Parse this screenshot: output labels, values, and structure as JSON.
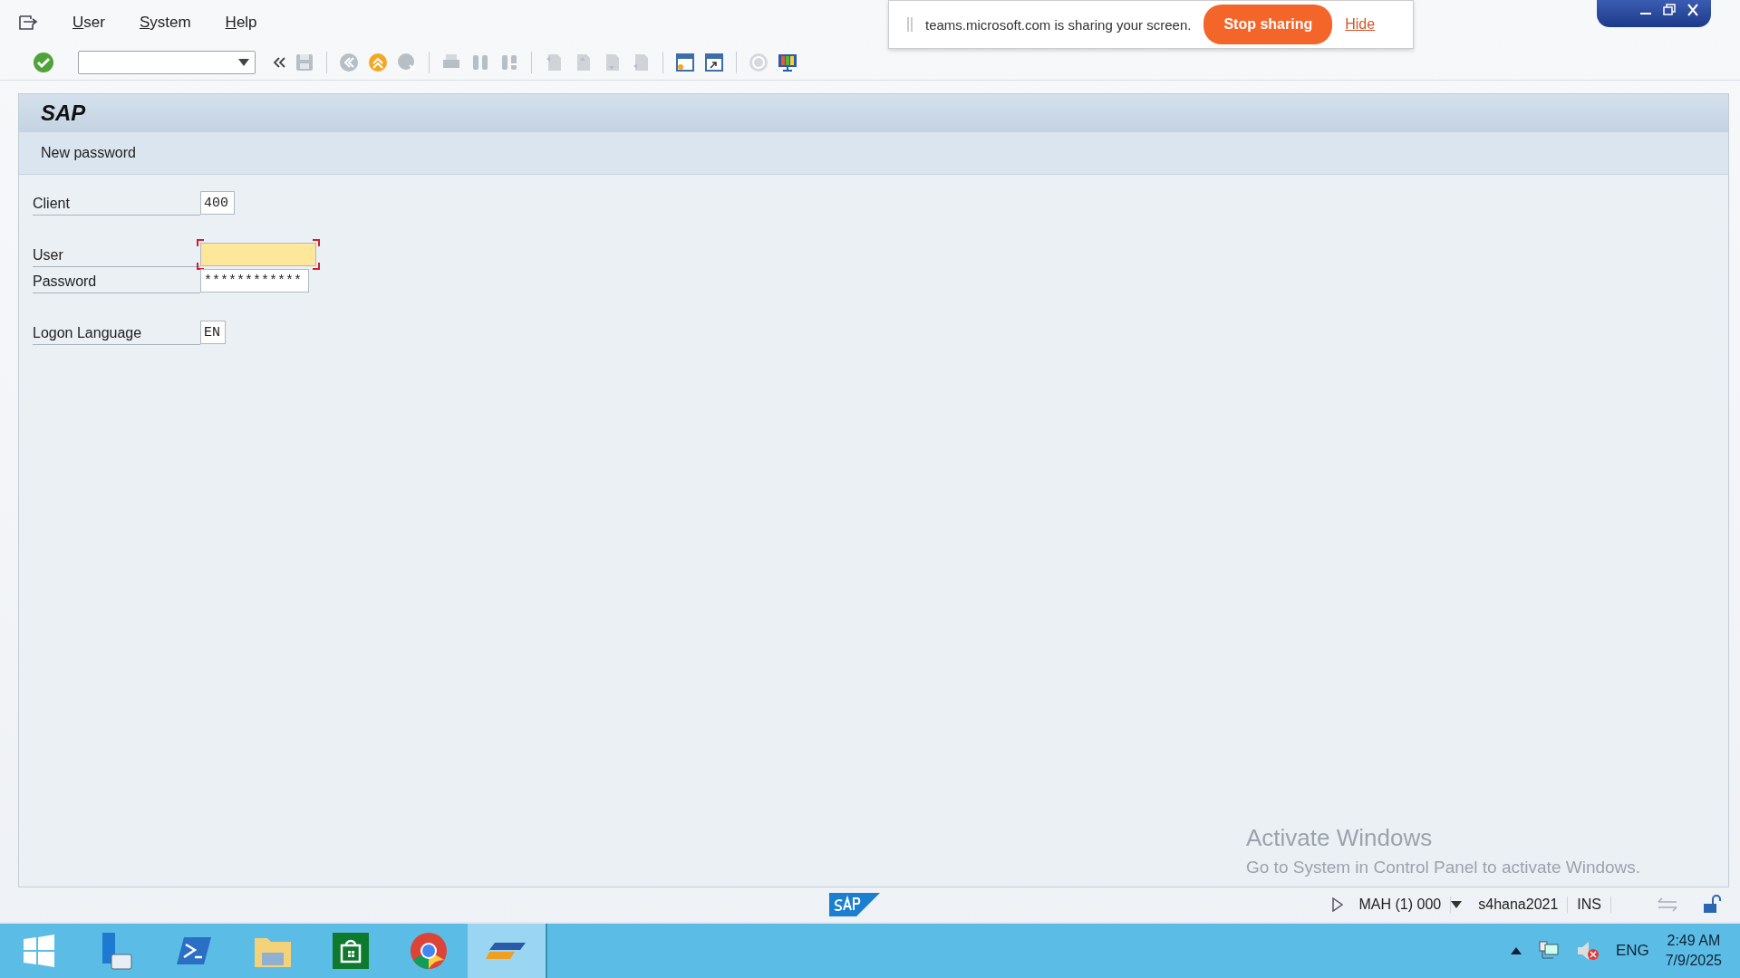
{
  "menu": [
    {
      "label": "User"
    },
    {
      "label": "System"
    },
    {
      "label": "Help"
    }
  ],
  "screen_sharing_banner": {
    "message": "teams.microsoft.com is sharing your screen.",
    "stop_button": "Stop sharing",
    "hide_link": "Hide"
  },
  "header": {
    "title": "SAP",
    "subtitle": "New password"
  },
  "fields": [
    {
      "label": "Client",
      "value": "400",
      "focused": false
    },
    {
      "label": "User",
      "focused": true
    },
    {
      "label": "Password",
      "value": "************",
      "focused": false
    },
    {
      "label": "Logon Language",
      "value": "EN",
      "focused": false
    }
  ],
  "activation_notice": {
    "title": "Activate Windows",
    "text": "Go to System in Control Panel to activate Windows."
  },
  "status_bar": {
    "session": "MAH (1) 000",
    "server": "s4hana2021",
    "mode": "INS"
  },
  "taskbar": {
    "apps": [
      {
        "selected": false
      },
      {
        "selected": false
      },
      {
        "selected": false
      },
      {
        "selected": false
      },
      {
        "selected": false
      },
      {
        "selected": true
      }
    ],
    "language": "ENG",
    "time": "2:49 AM",
    "date": "7/9/2025"
  }
}
